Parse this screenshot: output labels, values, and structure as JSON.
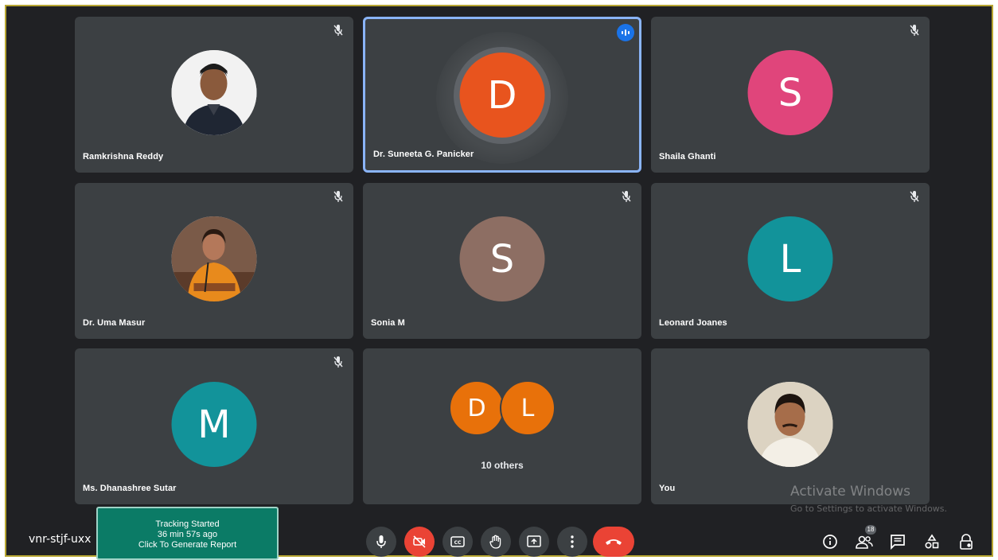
{
  "meeting": {
    "code": "vnr-stjf-uxx"
  },
  "tracking": {
    "line1": "Tracking Started",
    "line2": "36 min 57s ago",
    "line3": "Click To Generate Report"
  },
  "participants": [
    {
      "name": "Ramkrishna Reddy",
      "initial": "",
      "type": "photo",
      "muted": true
    },
    {
      "name": "Dr. Suneeta G. Panicker",
      "initial": "D",
      "color": "#e8541e",
      "speaking": true
    },
    {
      "name": "Shaila Ghanti",
      "initial": "S",
      "color": "#e0457b",
      "muted": true
    },
    {
      "name": "Dr. Uma Masur",
      "initial": "",
      "type": "photo",
      "muted": true
    },
    {
      "name": "Sonia M",
      "initial": "S",
      "color": "#8d6e63",
      "muted": true
    },
    {
      "name": "Leonard Joanes",
      "initial": "L",
      "color": "#12939a",
      "muted": true
    },
    {
      "name": "Ms. Dhanashree Sutar",
      "initial": "M",
      "color": "#12939a",
      "muted": true
    },
    {
      "name": "You",
      "initial": "",
      "type": "photo"
    }
  ],
  "others": {
    "initials": [
      "D",
      "L"
    ],
    "colors": [
      "#e8710a",
      "#e8710a"
    ],
    "label": "10 others"
  },
  "watermark": {
    "title": "Activate Windows",
    "subtitle": "Go to Settings to activate Windows."
  },
  "controls": [
    {
      "name": "microphone",
      "icon": "mic-icon"
    },
    {
      "name": "camera",
      "icon": "camera-off-icon",
      "state": "off"
    },
    {
      "name": "captions",
      "icon": "captions-icon"
    },
    {
      "name": "raise-hand",
      "icon": "hand-icon"
    },
    {
      "name": "present",
      "icon": "present-icon"
    },
    {
      "name": "more-options",
      "icon": "more-vert-icon"
    },
    {
      "name": "leave-call",
      "icon": "phone-hangup-icon"
    }
  ],
  "people_count": "18",
  "colors": {
    "background": "#202124",
    "tile": "#3c4043",
    "speaking_border": "#8ab4f8",
    "danger": "#ea4335",
    "tracking": "#0b7b66"
  }
}
